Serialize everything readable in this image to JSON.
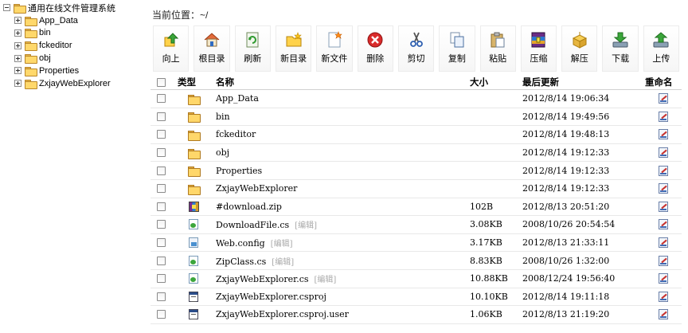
{
  "tree": {
    "root": {
      "label": "通用在线文件管理系统",
      "expanded": true
    },
    "children": [
      {
        "label": "App_Data",
        "expanded": false
      },
      {
        "label": "bin",
        "expanded": false
      },
      {
        "label": "fckeditor",
        "expanded": false
      },
      {
        "label": "obj",
        "expanded": false
      },
      {
        "label": "Properties",
        "expanded": false
      },
      {
        "label": "ZxjayWebExplorer",
        "expanded": false
      }
    ]
  },
  "location": {
    "text": "当前位置：~/"
  },
  "toolbar": {
    "buttons": [
      {
        "label": "向上",
        "icon": "up-arrow-icon"
      },
      {
        "label": "根目录",
        "icon": "home-icon"
      },
      {
        "label": "刷新",
        "icon": "refresh-icon"
      },
      {
        "label": "新目录",
        "icon": "new-folder-icon"
      },
      {
        "label": "新文件",
        "icon": "new-file-icon"
      },
      {
        "label": "删除",
        "icon": "delete-icon"
      },
      {
        "label": "剪切",
        "icon": "scissors-icon"
      },
      {
        "label": "复制",
        "icon": "copy-icon"
      },
      {
        "label": "粘贴",
        "icon": "paste-icon"
      },
      {
        "label": "压缩",
        "icon": "compress-icon"
      },
      {
        "label": "解压",
        "icon": "extract-icon"
      },
      {
        "label": "下载",
        "icon": "download-icon"
      },
      {
        "label": "上传",
        "icon": "upload-icon"
      }
    ]
  },
  "table": {
    "headers": {
      "type": "类型",
      "name": "名称",
      "size": "大小",
      "modified": "最后更新",
      "rename": "重命名"
    },
    "rows": [
      {
        "type": "folder",
        "name": "App_Data",
        "edit": "",
        "size": "",
        "modified": "2012/8/14 19:06:34"
      },
      {
        "type": "folder",
        "name": "bin",
        "edit": "",
        "size": "",
        "modified": "2012/8/14 19:49:56"
      },
      {
        "type": "folder",
        "name": "fckeditor",
        "edit": "",
        "size": "",
        "modified": "2012/8/14 19:48:13"
      },
      {
        "type": "folder",
        "name": "obj",
        "edit": "",
        "size": "",
        "modified": "2012/8/14 19:12:33"
      },
      {
        "type": "folder",
        "name": "Properties",
        "edit": "",
        "size": "",
        "modified": "2012/8/14 19:12:33"
      },
      {
        "type": "folder",
        "name": "ZxjayWebExplorer",
        "edit": "",
        "size": "",
        "modified": "2012/8/14 19:12:33"
      },
      {
        "type": "zip",
        "name": "#download.zip",
        "edit": "",
        "size": "102B",
        "modified": "2012/8/13 20:51:20"
      },
      {
        "type": "cs",
        "name": "DownloadFile.cs",
        "edit": "[编辑]",
        "size": "3.08KB",
        "modified": "2008/10/26 20:54:54"
      },
      {
        "type": "config",
        "name": "Web.config",
        "edit": "[编辑]",
        "size": "3.17KB",
        "modified": "2012/8/13 21:33:11"
      },
      {
        "type": "cs",
        "name": "ZipClass.cs",
        "edit": "[编辑]",
        "size": "8.83KB",
        "modified": "2008/10/26 1:32:00"
      },
      {
        "type": "cs",
        "name": "ZxjayWebExplorer.cs",
        "edit": "[编辑]",
        "size": "10.88KB",
        "modified": "2008/12/24 19:56:40"
      },
      {
        "type": "proj",
        "name": "ZxjayWebExplorer.csproj",
        "edit": "",
        "size": "10.10KB",
        "modified": "2012/8/14 19:11:18"
      },
      {
        "type": "proj",
        "name": "ZxjayWebExplorer.csproj.user",
        "edit": "",
        "size": "1.06KB",
        "modified": "2012/8/13 21:19:20"
      }
    ]
  }
}
